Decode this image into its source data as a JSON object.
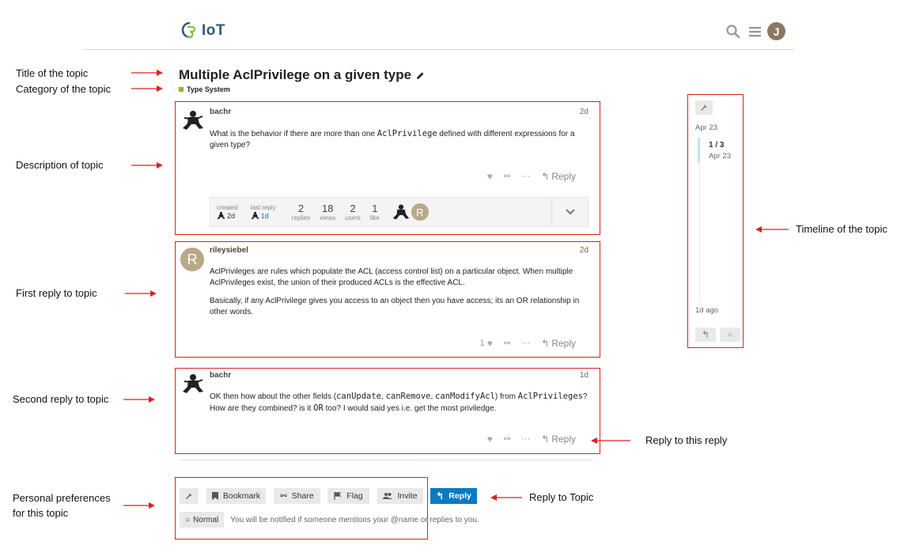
{
  "header": {
    "logo_text": "IoT",
    "avatar_initial": "J"
  },
  "topic": {
    "title": "Multiple AclPrivilege on a given type",
    "category": "Type System",
    "category_color": "#8cb43c"
  },
  "annotations": {
    "title": "Title of the topic",
    "category": "Category of the topic",
    "description": "Description of topic",
    "first_reply": "First reply to topic",
    "second_reply": "Second reply to topic",
    "preferences_line1": "Personal preferences",
    "preferences_line2": "for this topic",
    "timeline": "Timeline of the topic",
    "reply_to_reply": "Reply to this reply",
    "reply_to_topic": "Reply to Topic"
  },
  "posts": [
    {
      "username": "bachr",
      "date": "2d",
      "body_pre": "What is the behavior if there are more than one ",
      "body_code": "AclPrivilege",
      "body_post": " defined with different expressions for a given type?",
      "reply_label": "Reply"
    },
    {
      "username": "rileysiebel",
      "avatar_initial": "R",
      "date": "2d",
      "p1": "AclPrivileges are rules which populate the ACL (access control list) on a particular object. When multiple AclPrivileges exist, the union of their produced ACLs is the effective ACL.",
      "p2": "Basically, if any AclPrivilege gives you access to an object then you have access; its an OR relationship in other words.",
      "like_count": "1",
      "reply_label": "Reply"
    },
    {
      "username": "bachr",
      "date": "1d",
      "l1_a": "OK then how about the other fields (",
      "l1_c1": "canUpdate",
      "l1_b": ", ",
      "l1_c2": "canRemove",
      "l1_d": ", ",
      "l1_c3": "canModifyAcl",
      "l1_e": ") from ",
      "l1_c4": "AclPrivileges",
      "l1_f": "?",
      "l2_a": "How are they combined? is it ",
      "l2_code": "OR",
      "l2_b": " too? I would said yes i.e. get the most priviledge.",
      "reply_label": "Reply"
    }
  ],
  "topic_map": {
    "created_label": "created",
    "created_value": "2d",
    "last_reply_label": "last reply",
    "last_reply_value": "1d",
    "replies_count": "2",
    "replies_label": "replies",
    "views_count": "18",
    "views_label": "views",
    "users_count": "2",
    "users_label": "users",
    "likes_count": "1",
    "likes_label": "like",
    "participant_initial": "R"
  },
  "timeline": {
    "start_date": "Apr 23",
    "position": "1 / 3",
    "position_date": "Apr 23",
    "end_label": "1d ago"
  },
  "footer": {
    "bookmark": "Bookmark",
    "share": "Share",
    "flag": "Flag",
    "invite": "Invite",
    "reply": "Reply",
    "notification_level": "Normal",
    "notification_text": "You will be notified if someone mentions your @name or replies to you."
  },
  "colors": {
    "accent": "#0a7ac2",
    "annotation": "#e02020",
    "brand": "#2c5d76"
  }
}
